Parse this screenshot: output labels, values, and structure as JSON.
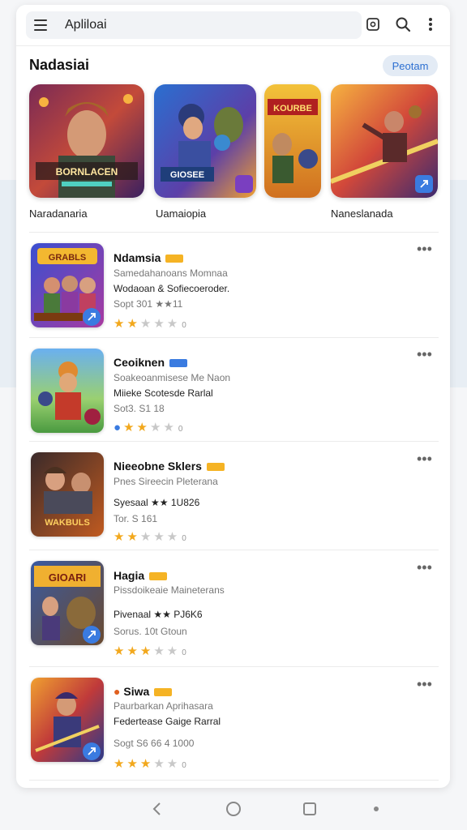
{
  "search": {
    "value": "Apliloai"
  },
  "section": {
    "title": "Nadasiai",
    "button_label": "Peotam"
  },
  "featured": [
    {
      "label": "Naradanaria",
      "art_text": "BORNLACEN"
    },
    {
      "label": "Uamaiopia",
      "art_text": "GIOSEE"
    },
    {
      "label": "",
      "art_text": "KOURBE"
    },
    {
      "label": "Naneslanada",
      "art_text": ""
    }
  ],
  "list": [
    {
      "title": "Ndamsia",
      "line1": "Samedahanoans Momnaa",
      "line2": "Wodaoan &  Sofiecoeroder.",
      "line3": "Sopt 301  ★★11",
      "rating": 2,
      "rating_tail": "0",
      "art_text": "GRABLS"
    },
    {
      "title": "Ceoiknen",
      "line1": "Soakeoanmisese Me Naon",
      "line2": "Miieke Scotesde Rarlal",
      "line3": "Sot3. S1  18",
      "rating": 3,
      "rating_tail": "0",
      "art_text": ""
    },
    {
      "title": "Nieeobne Sklers",
      "line1": "Pnes Sireecin Pleterana",
      "line2": "Syesaal ★★ 1U826",
      "line3": "Tor. S 161",
      "rating": 2,
      "rating_tail": "0",
      "art_text": "WAKBULS"
    },
    {
      "title": "Hagia",
      "line1": "Pissdoikeaie  Maineterans",
      "line2": "Pivenaal ★★ PJ6K6",
      "line3": "Sorus. 10t  Gtoun",
      "rating": 3,
      "rating_tail": "0",
      "art_text": "GIOARI"
    },
    {
      "title": "Siwa",
      "line1": "Paurbarkan Aprihasara",
      "line2": "Federtease Gaige Rarral",
      "line3": "Sogt S6  66  4 1000",
      "rating": 3,
      "rating_tail": "0",
      "art_text": ""
    }
  ],
  "colors": {
    "accent": "#2c6fd1",
    "star": "#f2a81d",
    "tag": "#f5b324"
  },
  "nav": [
    "back-icon",
    "home-icon",
    "recents-icon",
    "dot-icon"
  ]
}
